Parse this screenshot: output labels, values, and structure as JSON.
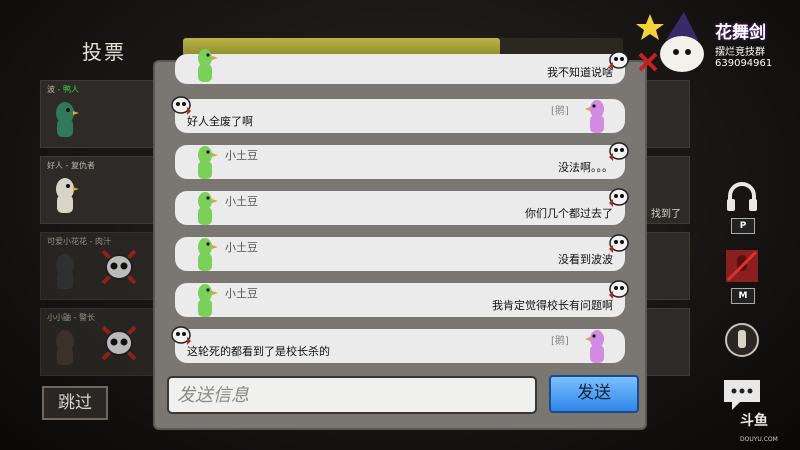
{
  "header": {
    "vote_title": "投票",
    "timer_fraction": 0.72
  },
  "players": [
    {
      "name": "波",
      "tag": "- 鸭人",
      "tag_color": "#3bd64b",
      "avatar_color": "#2f7a5a"
    },
    {
      "name": "好人 - 复仇者",
      "avatar_color": "#d8d4c8"
    },
    {
      "name": "可爱小花花 - 肉汁",
      "avatar_color": "#3a3a3a"
    },
    {
      "name": "小小鼬 - 警长",
      "avatar_color": "#4a3b35"
    }
  ],
  "right_panel": {
    "found_text": "找到了"
  },
  "skip_label": "跳过",
  "chat": {
    "messages": [
      {
        "sender": "",
        "text": "我不知道说啥",
        "align": "right",
        "tag": "",
        "goose_color": "#7bd05a"
      },
      {
        "sender": "",
        "text": "好人全废了啊",
        "align": "left",
        "tag": "[鹅]",
        "goose_color": "#d28be0"
      },
      {
        "sender": "小土豆",
        "text": "没法啊。。。",
        "align": "right",
        "tag": "",
        "goose_color": "#7bd05a"
      },
      {
        "sender": "小土豆",
        "text": "你们几个都过去了",
        "align": "right",
        "tag": "",
        "goose_color": "#7bd05a"
      },
      {
        "sender": "小土豆",
        "text": "没看到波波",
        "align": "right",
        "tag": "",
        "goose_color": "#7bd05a"
      },
      {
        "sender": "小土豆",
        "text": "我肯定觉得校长有问题啊",
        "align": "right",
        "tag": "",
        "goose_color": "#7bd05a"
      },
      {
        "sender": "",
        "text": "这轮死的都看到了是校长杀的",
        "align": "left",
        "tag": "[鹅]",
        "goose_color": "#d28be0"
      }
    ],
    "input_placeholder": "发送信息",
    "send_label": "发送"
  },
  "side_buttons": {
    "headset_key": "P",
    "mic_key": "M"
  },
  "branding": {
    "title": "花舞剑",
    "subtitle": "摆烂竞技群",
    "qq": "639094961",
    "watermark": "斗鱼",
    "watermark_sub": "DOUYU.COM"
  },
  "colors": {
    "send_button": "#2f86e8",
    "timer": "#b9b44a",
    "chat_bubble": "#ecebec"
  }
}
